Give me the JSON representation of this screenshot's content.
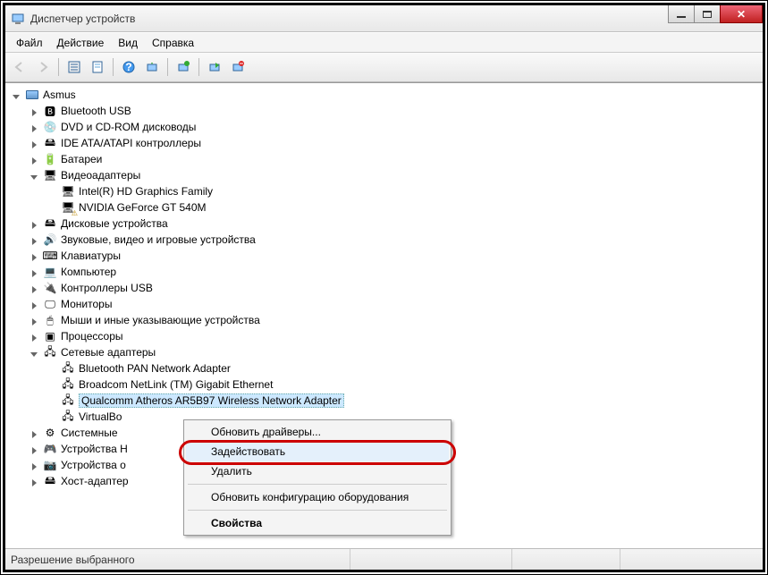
{
  "title": "Диспетчер устройств",
  "menu": {
    "file": "Файл",
    "action": "Действие",
    "view": "Вид",
    "help": "Справка"
  },
  "toolbar_icons": [
    "back",
    "forward",
    "list",
    "properties",
    "help",
    "refresh",
    "scan",
    "enable",
    "uninstall",
    "update"
  ],
  "root": "Asmus",
  "categories": [
    {
      "label": "Bluetooth USB",
      "icon": "bt",
      "expanded": false
    },
    {
      "label": "DVD и CD-ROM дисководы",
      "icon": "disc",
      "expanded": false
    },
    {
      "label": "IDE ATA/ATAPI контроллеры",
      "icon": "ide",
      "expanded": false
    },
    {
      "label": "Батареи",
      "icon": "bat",
      "expanded": false
    },
    {
      "label": "Видеоадаптеры",
      "icon": "display",
      "expanded": true,
      "children": [
        {
          "label": "Intel(R) HD Graphics Family",
          "icon": "display"
        },
        {
          "label": "NVIDIA GeForce GT 540M",
          "icon": "display",
          "warning": true
        }
      ]
    },
    {
      "label": "Дисковые устройства",
      "icon": "hdd",
      "expanded": false
    },
    {
      "label": "Звуковые, видео и игровые устройства",
      "icon": "audio",
      "expanded": false
    },
    {
      "label": "Клавиатуры",
      "icon": "kb",
      "expanded": false
    },
    {
      "label": "Компьютер",
      "icon": "pc",
      "expanded": false
    },
    {
      "label": "Контроллеры USB",
      "icon": "usb",
      "expanded": false
    },
    {
      "label": "Мониторы",
      "icon": "monitor",
      "expanded": false
    },
    {
      "label": "Мыши и иные указывающие устройства",
      "icon": "mouse",
      "expanded": false
    },
    {
      "label": "Процессоры",
      "icon": "cpu",
      "expanded": false
    },
    {
      "label": "Сетевые адаптеры",
      "icon": "net",
      "expanded": true,
      "children": [
        {
          "label": "Bluetooth PAN Network Adapter",
          "icon": "net"
        },
        {
          "label": "Broadcom NetLink (TM) Gigabit Ethernet",
          "icon": "net"
        },
        {
          "label": "Qualcomm Atheros AR5B97 Wireless Network Adapter",
          "icon": "net",
          "selected": true
        },
        {
          "label": "VirtualBo",
          "icon": "net",
          "truncated": true
        }
      ]
    },
    {
      "label": "Системные",
      "icon": "sys",
      "truncated": true,
      "expanded": false
    },
    {
      "label": "Устройства H",
      "icon": "hid",
      "truncated": true,
      "expanded": false
    },
    {
      "label": "Устройства о",
      "icon": "img",
      "truncated": true,
      "expanded": false
    },
    {
      "label": "Хост-адаптер",
      "icon": "host",
      "truncated": true,
      "expanded": false
    }
  ],
  "context_menu": {
    "items": [
      {
        "label": "Обновить драйверы...",
        "type": "item"
      },
      {
        "label": "Задействовать",
        "type": "item",
        "highlighted": true
      },
      {
        "label": "Удалить",
        "type": "item"
      },
      {
        "type": "sep"
      },
      {
        "label": "Обновить конфигурацию оборудования",
        "type": "item"
      },
      {
        "type": "sep"
      },
      {
        "label": "Свойства",
        "type": "item",
        "bold": true
      }
    ]
  },
  "statusbar": "Разрешение выбранного"
}
